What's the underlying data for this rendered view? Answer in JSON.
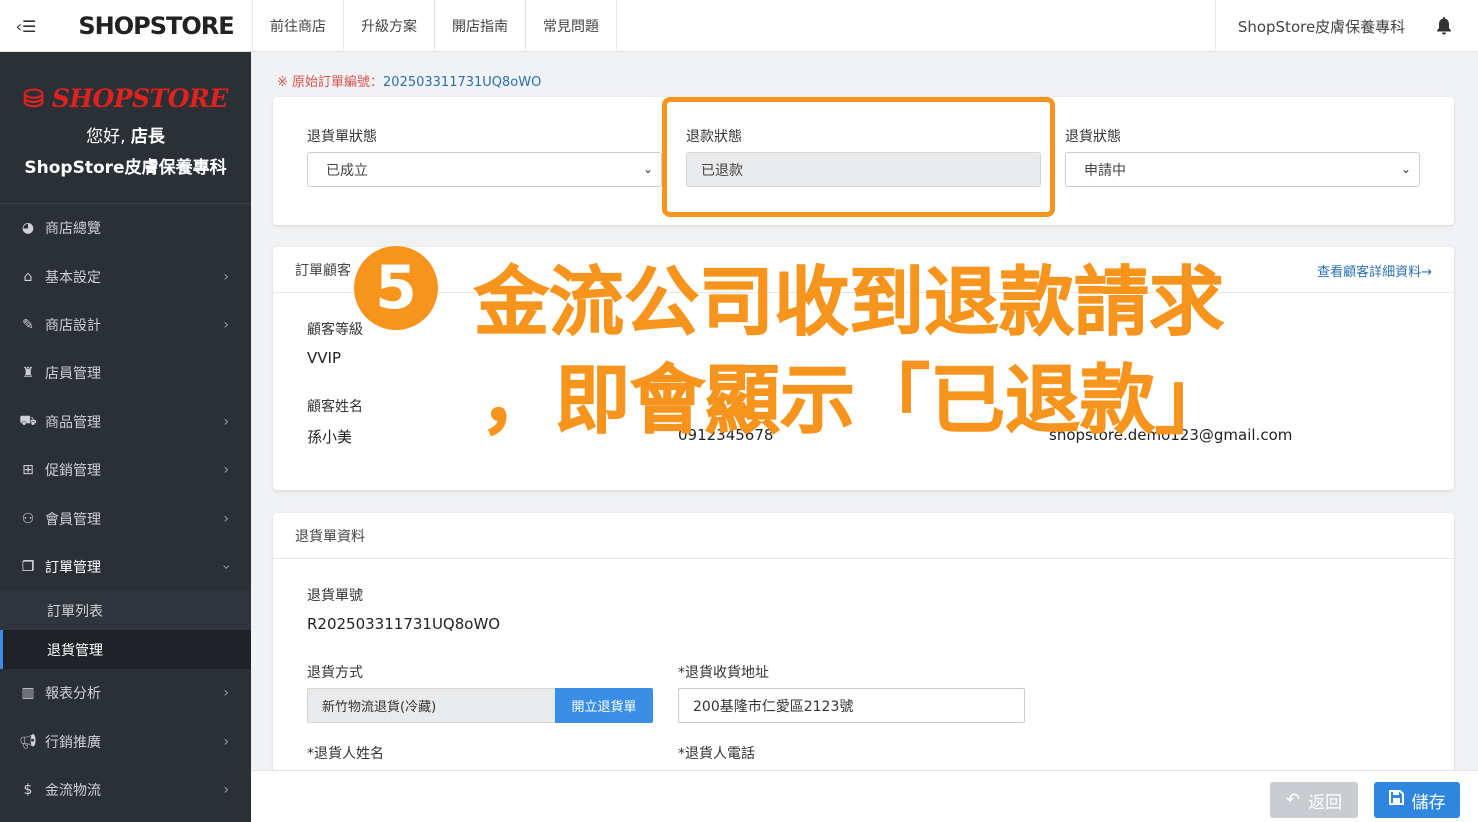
{
  "topbar": {
    "logo_text": "SHOPSTORE",
    "nav": [
      "前往商店",
      "升級方案",
      "開店指南",
      "常見問題"
    ],
    "store_name": "ShopStore皮膚保養專科"
  },
  "sidebar": {
    "logo_text": "SHOPSTORE",
    "greeting_prefix": "您好,",
    "greeting_name": "店長",
    "store_name": "ShopStore皮膚保養專科",
    "items": [
      {
        "label": "商店總覽",
        "icon": "dashboard-icon",
        "chevron": false
      },
      {
        "label": "基本設定",
        "icon": "bank-icon",
        "chevron": true
      },
      {
        "label": "商店設計",
        "icon": "magic-wand-icon",
        "chevron": true
      },
      {
        "label": "店員管理",
        "icon": "user-lock-icon",
        "chevron": false
      },
      {
        "label": "商品管理",
        "icon": "cart-icon",
        "chevron": true
      },
      {
        "label": "促銷管理",
        "icon": "gift-icon",
        "chevron": true
      },
      {
        "label": "會員管理",
        "icon": "users-icon",
        "chevron": true
      },
      {
        "label": "訂單管理",
        "icon": "copy-icon",
        "chevron": true
      },
      {
        "label": "報表分析",
        "icon": "bar-chart-icon",
        "chevron": true
      },
      {
        "label": "行銷推廣",
        "icon": "bullhorn-icon",
        "chevron": true
      },
      {
        "label": "金流物流",
        "icon": "dollar-icon",
        "chevron": true
      }
    ],
    "sub_items": [
      {
        "label": "訂單列表"
      },
      {
        "label": "退貨管理"
      }
    ]
  },
  "main": {
    "orig_order_label": "※ 原始訂單編號：",
    "orig_order_no": "202503311731UQ8oWO",
    "status": {
      "return_order_label": "退貨單狀態",
      "return_order_value": "已成立",
      "refund_label": "退款狀態",
      "refund_value": "已退款",
      "return_label": "退貨狀態",
      "return_value": "申請中"
    },
    "customer": {
      "title": "訂單顧客",
      "detail_link": "查看顧客詳細資料→",
      "level_label": "顧客等級",
      "level_value": "VVIP",
      "name_label": "顧客姓名",
      "name_value": "孫小美",
      "phone_value": "0912345678",
      "email_value": "shopstore.demo123@gmail.com"
    },
    "return_info": {
      "title": "退貨單資料",
      "no_label": "退貨單號",
      "no_value": "R202503311731UQ8oWO",
      "method_label": "退貨方式",
      "method_value": "新竹物流退貨(冷藏)",
      "create_btn": "開立退貨單",
      "address_label": "*退貨收貨地址",
      "address_value": "200基隆市仁愛區2123號",
      "person_label": "*退貨人姓名",
      "phone_label": "*退貨人電話"
    }
  },
  "annotation": {
    "number": "5",
    "line1": "金流公司收到退款請求",
    "line2": "，即會顯示「已退款」"
  },
  "bottombar": {
    "back_label": "返回",
    "save_label": "儲存"
  }
}
